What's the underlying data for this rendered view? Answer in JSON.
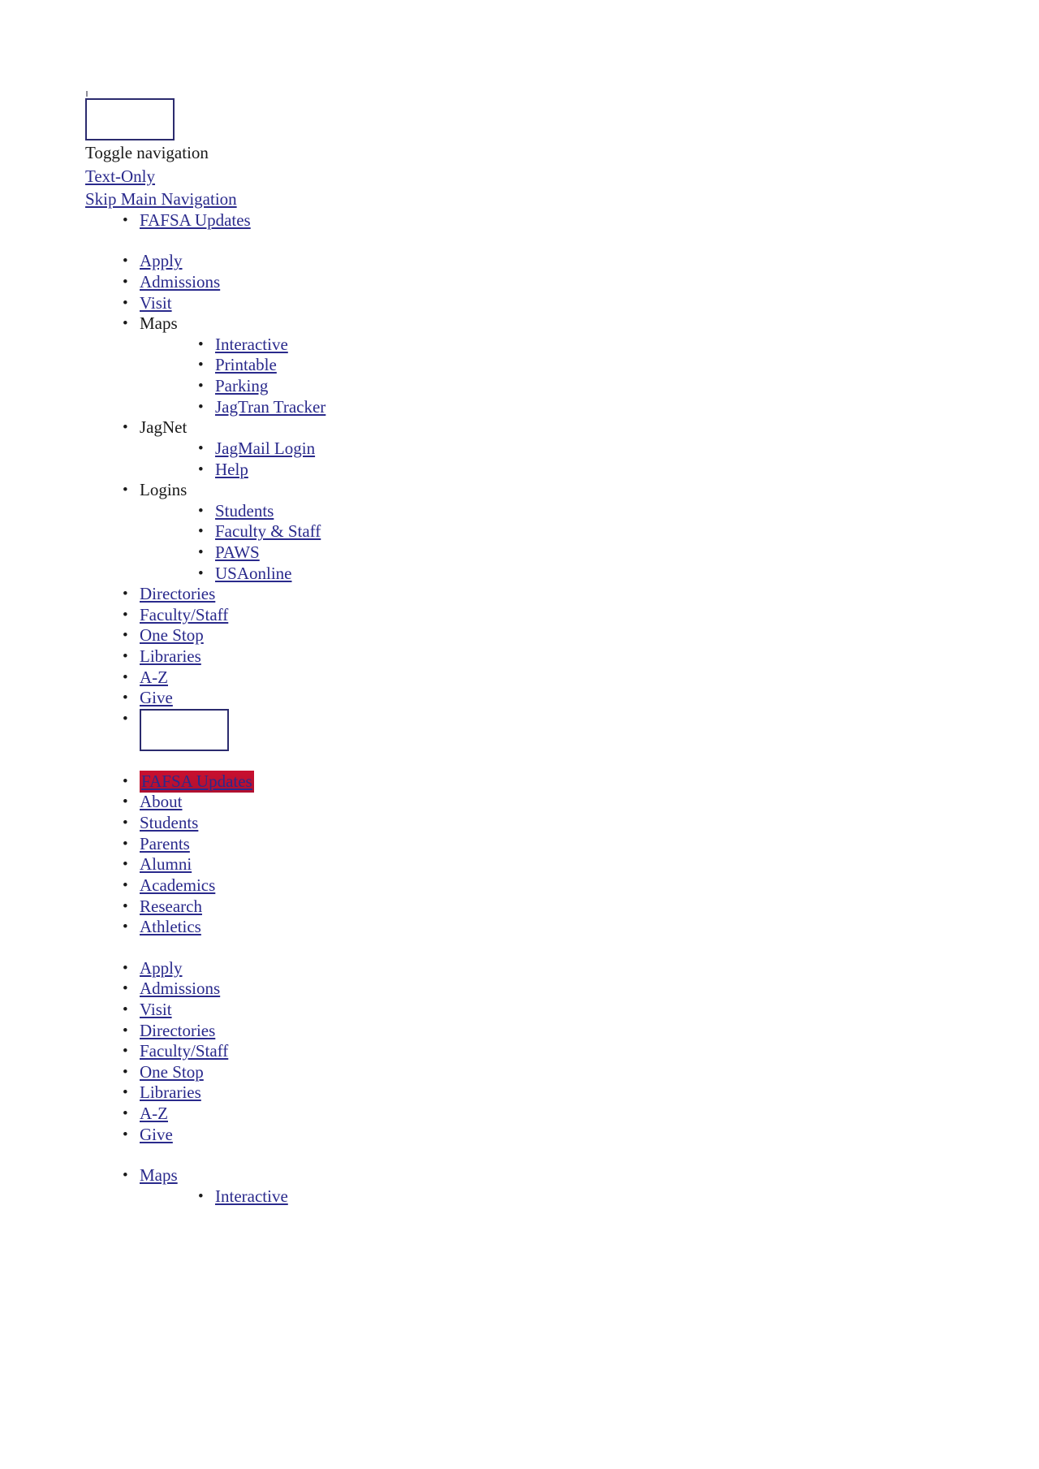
{
  "page": {
    "toggle_label": "Toggle navigation",
    "text_only_label": "Text-Only",
    "skip_nav_label": "Skip Main Navigation",
    "logo_box_name": "site-logo-placeholder",
    "search_box_name": "search-input",
    "link_color": "#2a2a8c",
    "text_color": "#1a1a1a",
    "highlight_bg_color": "#c4102e",
    "box_border_color": "#2b2b6e"
  },
  "utility_nav": {
    "items": [
      {
        "label": "FAFSA Updates",
        "type": "link"
      }
    ]
  },
  "primary_nav": {
    "items": [
      {
        "label": "Apply",
        "type": "link"
      },
      {
        "label": "Admissions",
        "type": "link"
      },
      {
        "label": "Visit",
        "type": "link"
      },
      {
        "label": "Maps",
        "type": "text",
        "children": [
          {
            "label": "Interactive",
            "type": "link"
          },
          {
            "label": "Printable",
            "type": "link"
          },
          {
            "label": "Parking",
            "type": "link"
          },
          {
            "label": "JagTran Tracker",
            "type": "link"
          }
        ]
      },
      {
        "label": "JagNet",
        "type": "text",
        "children": [
          {
            "label": "JagMail Login",
            "type": "link"
          },
          {
            "label": "Help",
            "type": "link"
          }
        ]
      },
      {
        "label": "Logins",
        "type": "text",
        "children": [
          {
            "label": "Students",
            "type": "link"
          },
          {
            "label": "Faculty & Staff",
            "type": "link"
          },
          {
            "label": "PAWS",
            "type": "link"
          },
          {
            "label": "USAonline",
            "type": "link"
          }
        ]
      },
      {
        "label": "Directories",
        "type": "link"
      },
      {
        "label": "Faculty/Staff",
        "type": "link"
      },
      {
        "label": "One Stop",
        "type": "link"
      },
      {
        "label": "Libraries",
        "type": "link"
      },
      {
        "label": "A-Z",
        "type": "link"
      },
      {
        "label": "Give",
        "type": "link"
      }
    ]
  },
  "audience_nav": {
    "items": [
      {
        "label": "FAFSA Updates",
        "type": "link",
        "highlighted": true
      },
      {
        "label": "About",
        "type": "link"
      },
      {
        "label": "Students",
        "type": "link"
      },
      {
        "label": "Parents",
        "type": "link"
      },
      {
        "label": "Alumni",
        "type": "link"
      },
      {
        "label": "Academics",
        "type": "link"
      },
      {
        "label": "Research",
        "type": "link"
      },
      {
        "label": "Athletics",
        "type": "link"
      }
    ]
  },
  "footer_nav": {
    "items": [
      {
        "label": "Apply",
        "type": "link"
      },
      {
        "label": "Admissions",
        "type": "link"
      },
      {
        "label": "Visit",
        "type": "link"
      },
      {
        "label": "Directories",
        "type": "link"
      },
      {
        "label": "Faculty/Staff",
        "type": "link"
      },
      {
        "label": "One Stop",
        "type": "link"
      },
      {
        "label": "Libraries",
        "type": "link"
      },
      {
        "label": "A-Z",
        "type": "link"
      },
      {
        "label": "Give",
        "type": "link"
      }
    ]
  },
  "maps_nav": {
    "items": [
      {
        "label": "Maps",
        "type": "link",
        "children": [
          {
            "label": "Interactive",
            "type": "link"
          }
        ]
      }
    ]
  }
}
